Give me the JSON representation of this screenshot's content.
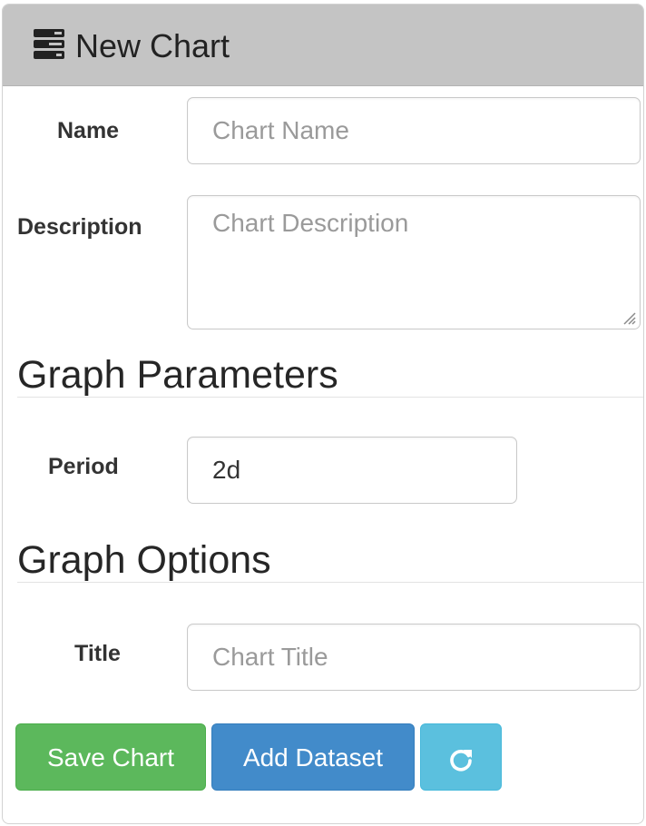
{
  "panel": {
    "title": "New Chart",
    "title_icon": "tasks-icon"
  },
  "form": {
    "name": {
      "label": "Name",
      "placeholder": "Chart Name",
      "value": ""
    },
    "description": {
      "label": "Description",
      "placeholder": "Chart Description",
      "value": ""
    }
  },
  "graph_parameters": {
    "heading": "Graph Parameters",
    "period": {
      "label": "Period",
      "value": "2d"
    }
  },
  "graph_options": {
    "heading": "Graph Options",
    "title": {
      "label": "Title",
      "placeholder": "Chart Title",
      "value": ""
    }
  },
  "buttons": {
    "save_label": "Save Chart",
    "add_dataset_label": "Add Dataset",
    "refresh_icon": "refresh-icon"
  },
  "colors": {
    "heading_bg": "#c4c4c4",
    "success": "#5cb85c",
    "primary": "#428bca",
    "info": "#5bc0de"
  }
}
